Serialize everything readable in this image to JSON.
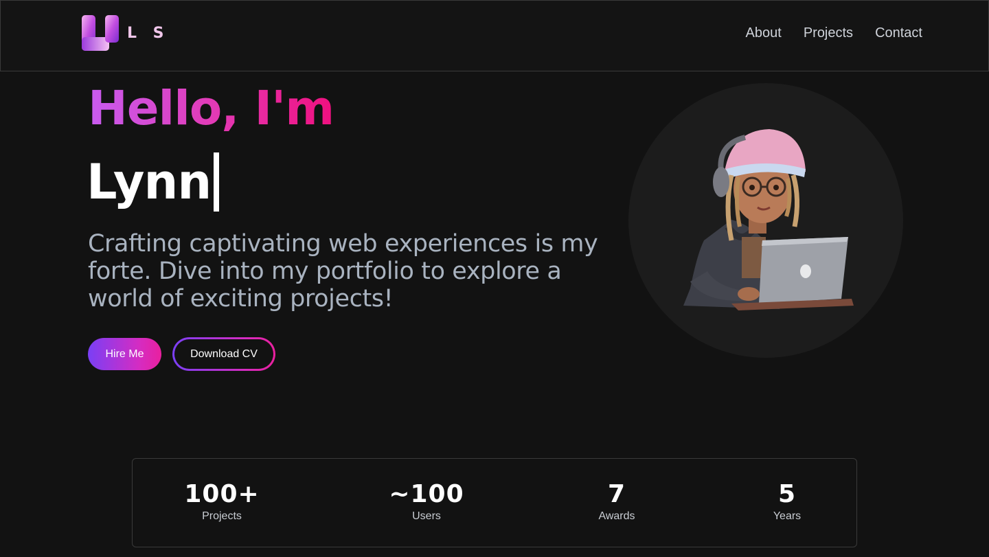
{
  "brand": {
    "logo_text": "L S",
    "logo_icon": "l-shape-logo-icon"
  },
  "nav": {
    "items": [
      {
        "label": "About"
      },
      {
        "label": "Projects"
      },
      {
        "label": "Contact"
      }
    ]
  },
  "hero": {
    "greeting": "Hello, I'm",
    "name": "Lynn",
    "tagline": "Crafting captivating web experiences is my forte. Dive into my portfolio to explore a world of exciting projects!",
    "hire_button": "Hire Me",
    "cv_button": "Download CV",
    "avatar_icon": "girl-with-laptop-illustration"
  },
  "stats": [
    {
      "value": "100+",
      "label": "Projects"
    },
    {
      "value": "~100",
      "label": "Users"
    },
    {
      "value": "7",
      "label": "Awards"
    },
    {
      "value": "5",
      "label": "Years"
    }
  ],
  "colors": {
    "background": "#121212",
    "gradient_start": "#7a3ff5",
    "gradient_end": "#e9209e",
    "hello_start": "#c85cf0",
    "hello_end": "#f0107f",
    "tagline": "#a9b3c0"
  }
}
